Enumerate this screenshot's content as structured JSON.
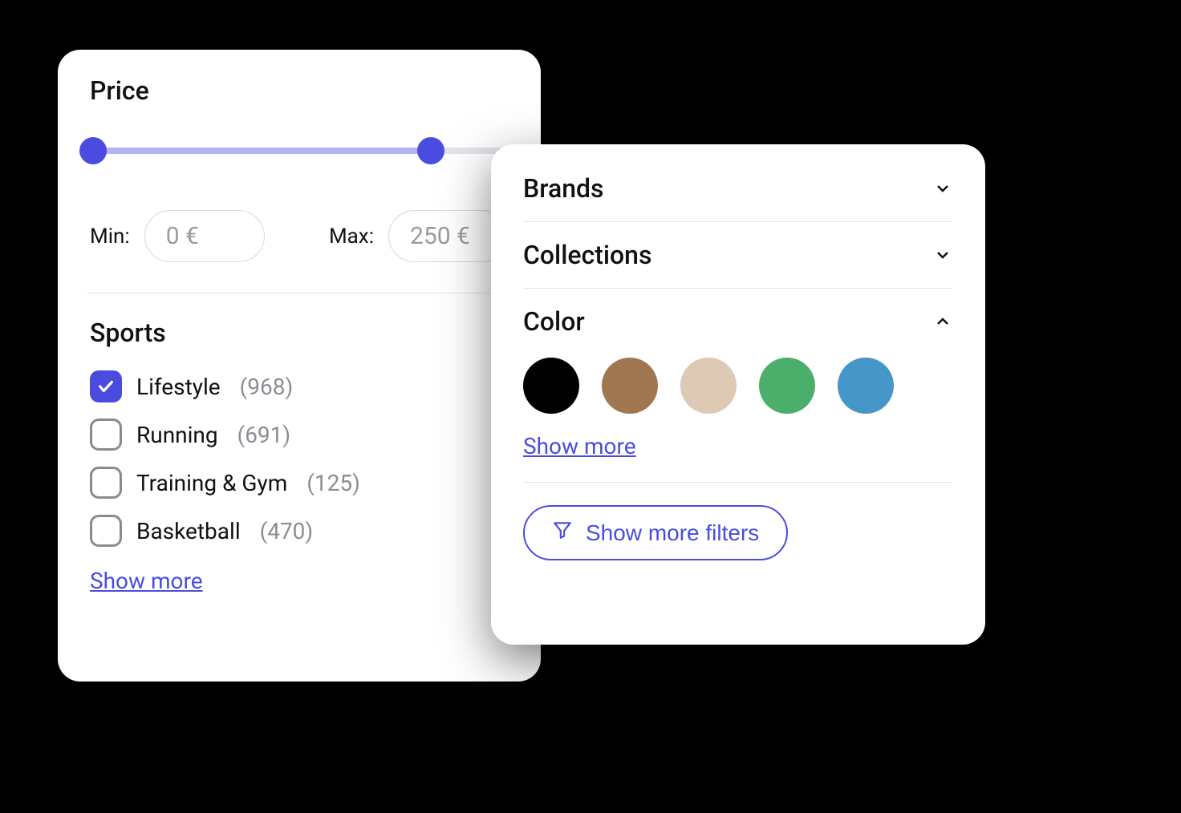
{
  "price": {
    "title": "Price",
    "min_label": "Min:",
    "max_label": "Max:",
    "min_value": "0 €",
    "max_value": "250 €"
  },
  "sports": {
    "title": "Sports",
    "items": [
      {
        "label": "Lifestyle",
        "count": "(968)",
        "checked": true
      },
      {
        "label": "Running",
        "count": "(691)",
        "checked": false
      },
      {
        "label": "Training & Gym",
        "count": "(125)",
        "checked": false
      },
      {
        "label": "Basketball",
        "count": "(470)",
        "checked": false
      }
    ],
    "show_more": "Show more"
  },
  "right": {
    "brands": "Brands",
    "collections": "Collections",
    "color_title": "Color",
    "colors": [
      "#000000",
      "#a07750",
      "#ddc9b4",
      "#4bae6a",
      "#4696c7"
    ],
    "show_more": "Show more",
    "show_more_filters": "Show more filters"
  }
}
